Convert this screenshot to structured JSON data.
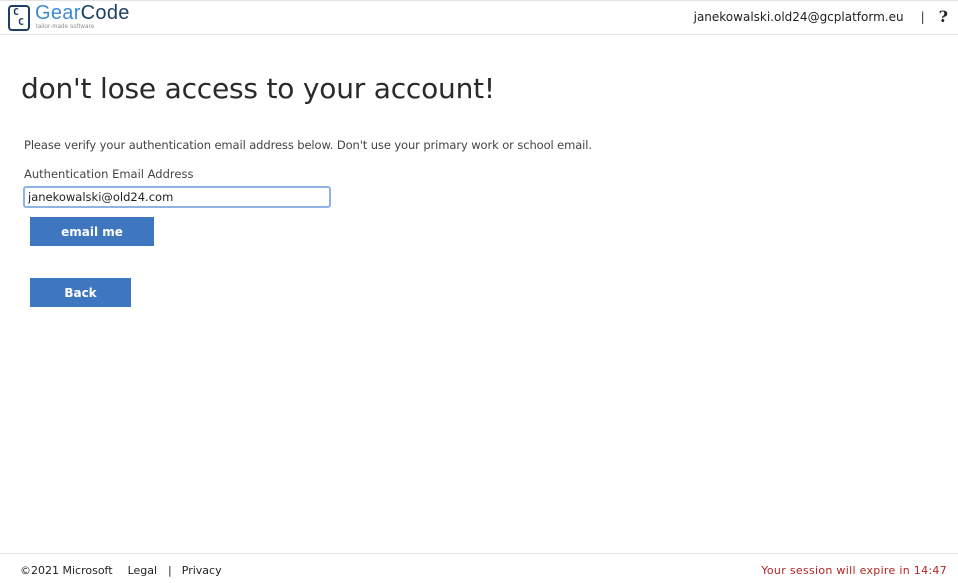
{
  "header": {
    "logo": {
      "brand_part1": "Gear",
      "brand_part2": "Code",
      "tagline": "tailor-made software",
      "icon": "gearcode-logo-icon"
    },
    "user_email": "janekowalski.old24@gcplatform.eu",
    "separator": "|",
    "help_symbol": "?"
  },
  "main": {
    "title": "don't lose access to your account!",
    "description": "Please verify your authentication email address below. Don't use your primary work or school email.",
    "field_label": "Authentication Email Address",
    "email_value": "janekowalski@old24.com",
    "email_button_label": "email me",
    "back_button_label": "Back"
  },
  "footer": {
    "copyright": "©2021 Microsoft",
    "legal_label": "Legal",
    "separator": "|",
    "privacy_label": "Privacy",
    "session_text": "Your session will expire in 14:47"
  },
  "colors": {
    "button": "#3e76bf",
    "input_border": "#8fb3e6",
    "session_warning": "#b22222",
    "logo_dark": "#1d3f66",
    "logo_light": "#3b8ad6"
  }
}
